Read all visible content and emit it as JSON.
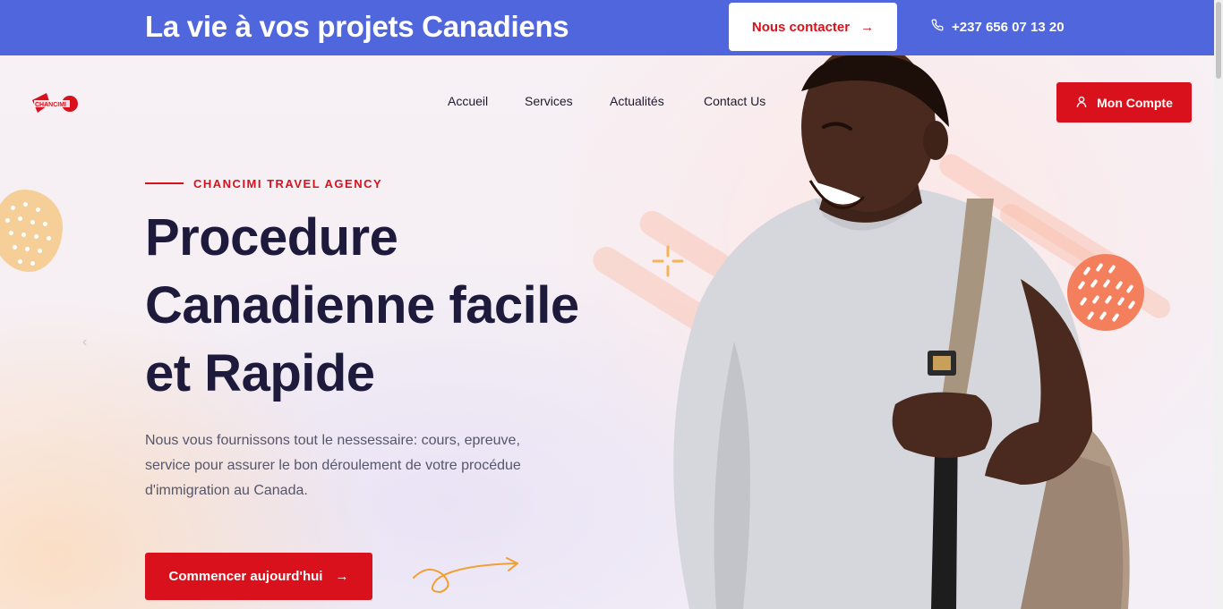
{
  "topbar": {
    "tagline": "La vie à vos projets Canadiens",
    "contact_button": "Nous contacter",
    "phone": "+237 656 07 13 20"
  },
  "header": {
    "logo_text": "CHANCIMI",
    "nav": [
      "Accueil",
      "Services",
      "Actualités",
      "Contact Us"
    ],
    "account_button": "Mon Compte"
  },
  "hero": {
    "eyebrow": "CHANCIMI TRAVEL AGENCY",
    "headline_lines": [
      "Procedure",
      "Canadienne facile",
      "et Rapide"
    ],
    "subtext_lines": [
      "Nous vous fournissons tout le nessessaire: cours, epreuve,",
      "service pour assurer le bon déroulement de votre procédue",
      "d'immigration au Canada."
    ],
    "cta_button": "Commencer aujourd'hui"
  },
  "icons": {
    "arrow": "arrow-right-icon",
    "phone": "phone-icon",
    "user": "user-icon",
    "prev": "chevron-left-icon"
  },
  "colors": {
    "topbar": "#5066dd",
    "accent_red": "#d8111c",
    "headline": "#1e1a3c",
    "blob_orange": "#f47f5d",
    "blob_peach": "#f6cf98"
  }
}
